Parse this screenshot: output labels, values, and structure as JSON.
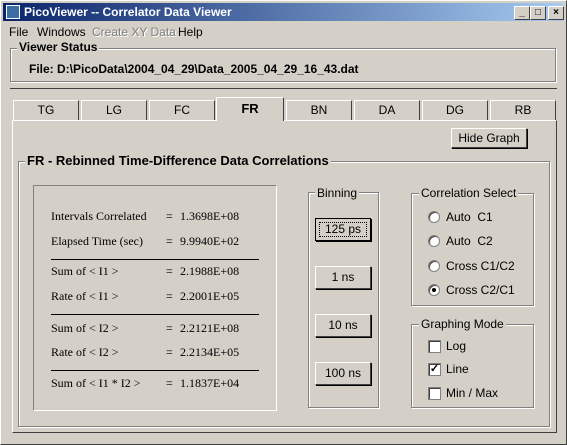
{
  "window": {
    "title": "PicoViewer -- Correlator Data Viewer",
    "min_glyph": "_",
    "max_glyph": "□",
    "close_glyph": "×"
  },
  "menu": {
    "file": "File",
    "windows": "Windows",
    "create_xy": "Create XY Data",
    "help": "Help"
  },
  "viewer_status": {
    "title": "Viewer Status",
    "file_line": "File: D:\\PicoData\\2004_04_29\\Data_2005_04_29_16_43.dat"
  },
  "tabs": [
    "TG",
    "LG",
    "FC",
    "FR",
    "BN",
    "DA",
    "DG",
    "RB"
  ],
  "active_tab": "FR",
  "hide_graph_label": "Hide Graph",
  "fr_group_title": "FR - Rebinned Time-Difference Data Correlations",
  "stats": [
    {
      "label": "Intervals Correlated",
      "value": "1.3698E+08"
    },
    {
      "label": "Elapsed Time (sec)",
      "value": "9.9940E+02"
    },
    {
      "label": "Sum of < I1 >",
      "value": "2.1988E+08"
    },
    {
      "label": "Rate of < I1 >",
      "value": "2.2001E+05"
    },
    {
      "label": "Sum of < I2 >",
      "value": "2.2121E+08"
    },
    {
      "label": "Rate of < I2 >",
      "value": "2.2134E+05"
    },
    {
      "label": "Sum of < I1 * I2 >",
      "value": "1.1837E+04"
    }
  ],
  "equals": "=",
  "binning": {
    "title": "Binning",
    "options": [
      "125 ps",
      "1 ns",
      "10 ns",
      "100 ns"
    ],
    "selected": "125 ps"
  },
  "correlation_select": {
    "title": "Correlation Select",
    "options": [
      "Auto  C1",
      "Auto  C2",
      "Cross C1/C2",
      "Cross C2/C1"
    ],
    "selected": "Cross C2/C1"
  },
  "graphing_mode": {
    "title": "Graphing Mode",
    "options": [
      {
        "label": "Log",
        "checked": false
      },
      {
        "label": "Line",
        "checked": true
      },
      {
        "label": "Min / Max",
        "checked": false
      }
    ],
    "check_glyph": "✓"
  }
}
